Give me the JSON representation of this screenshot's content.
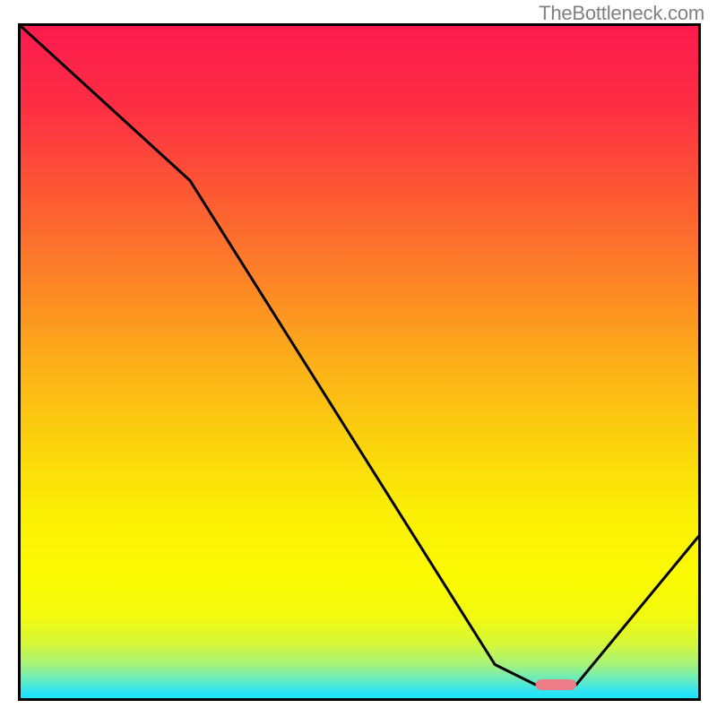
{
  "watermark": "TheBottleneck.com",
  "chart_data": {
    "type": "line",
    "title": "",
    "xlabel": "",
    "ylabel": "",
    "ylim": [
      0,
      100
    ],
    "xlim": [
      0,
      100
    ],
    "series": [
      {
        "name": "bottleneck-curve",
        "x": [
          0,
          25,
          70,
          76,
          82,
          100
        ],
        "values": [
          100,
          77,
          5,
          2,
          2,
          24
        ]
      },
      {
        "name": "optimal-marker",
        "x": [
          76,
          82
        ],
        "values": [
          2,
          2
        ]
      }
    ],
    "gradient_stops": [
      {
        "pos": 0.0,
        "color": "#fc1a4e"
      },
      {
        "pos": 0.12,
        "color": "#fd2e43"
      },
      {
        "pos": 0.25,
        "color": "#fd5934"
      },
      {
        "pos": 0.38,
        "color": "#fc8426"
      },
      {
        "pos": 0.5,
        "color": "#fcaf19"
      },
      {
        "pos": 0.62,
        "color": "#fbd30d"
      },
      {
        "pos": 0.72,
        "color": "#fbee05"
      },
      {
        "pos": 0.82,
        "color": "#fbfb02"
      },
      {
        "pos": 0.88,
        "color": "#f2fa0f"
      },
      {
        "pos": 0.92,
        "color": "#d4f73b"
      },
      {
        "pos": 0.95,
        "color": "#a5f27b"
      },
      {
        "pos": 0.97,
        "color": "#6eecb8"
      },
      {
        "pos": 0.99,
        "color": "#30e4f2"
      },
      {
        "pos": 1.0,
        "color": "#1be1ff"
      }
    ],
    "marker_color": "#ed7c89"
  }
}
